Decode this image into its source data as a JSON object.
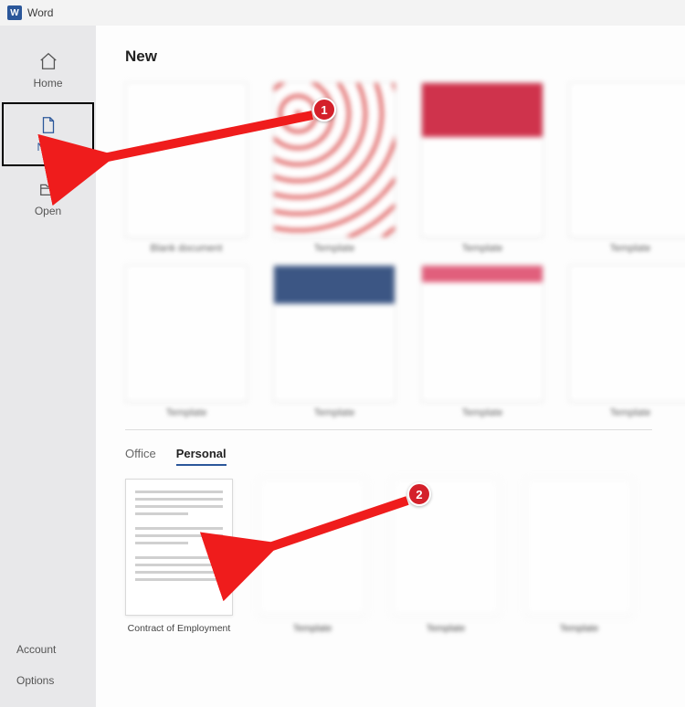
{
  "titlebar": {
    "app_name": "Word",
    "icon_letter": "W"
  },
  "sidebar": {
    "items": [
      {
        "key": "home",
        "label": "Home"
      },
      {
        "key": "new",
        "label": "New",
        "selected": true
      },
      {
        "key": "open",
        "label": "Open"
      }
    ],
    "bottom": {
      "account": "Account",
      "options": "Options"
    }
  },
  "main": {
    "heading": "New",
    "tabs": {
      "office": "Office",
      "personal": "Personal",
      "active": "personal"
    },
    "personal_template": {
      "name": "Contract of Employment"
    }
  },
  "annotations": {
    "badge1": "1",
    "badge2": "2"
  }
}
